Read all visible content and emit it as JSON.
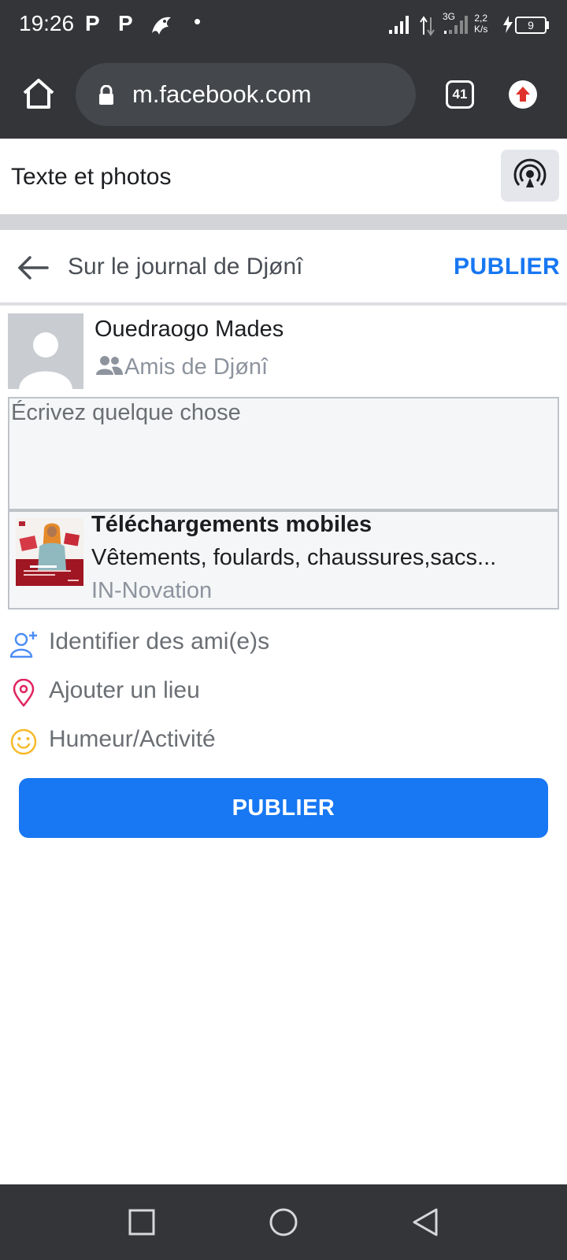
{
  "status_bar": {
    "time": "19:26",
    "notif_icons": [
      "P",
      "P"
    ],
    "network_type": "3G",
    "net_speed_value": "2,2",
    "net_speed_unit": "K/s",
    "battery_level": "9"
  },
  "browser": {
    "url": "m.facebook.com",
    "tab_count": "41"
  },
  "toolbar": {
    "label": "Texte et photos"
  },
  "header": {
    "title": "Sur le journal de Djønî",
    "publish_label": "PUBLIER"
  },
  "author": {
    "name": "Ouedraogo Mades",
    "audience": "Amis de Djønî"
  },
  "composer": {
    "placeholder": "Écrivez quelque chose"
  },
  "link_preview": {
    "title": "Téléchargements mobiles",
    "description": "Vêtements, foulards, chaussures,sacs...",
    "source": "IN-Novation"
  },
  "options": {
    "tag": "Identifier des ami(e)s",
    "place": "Ajouter un lieu",
    "mood": "Humeur/Activité"
  },
  "publish_button": "PUBLIER",
  "colors": {
    "accent": "#1877f2",
    "status_bar": "#333538",
    "place_icon": "#e0245e",
    "mood_icon": "#f7b928"
  }
}
